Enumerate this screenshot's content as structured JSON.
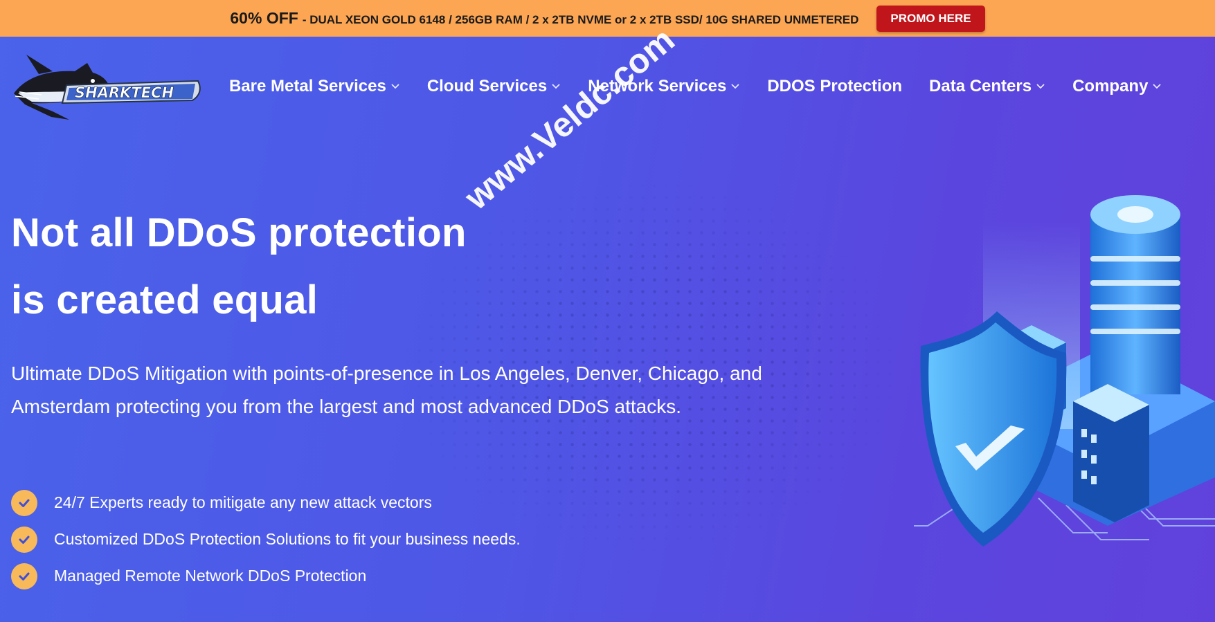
{
  "promo": {
    "highlight": "60% OFF",
    "detail": "- DUAL XEON GOLD 6148 / 256GB RAM / 2 x 2TB NVME or 2 x 2TB SSD/ 10G SHARED UNMETERED",
    "button_label": "PROMO HERE"
  },
  "logo": {
    "text": "SHARKTECH",
    "icon": "shark-logo"
  },
  "nav": [
    {
      "label": "Bare Metal Services",
      "has_dropdown": true
    },
    {
      "label": "Cloud Services",
      "has_dropdown": true
    },
    {
      "label": "Network Services",
      "has_dropdown": true
    },
    {
      "label": "DDOS Protection",
      "has_dropdown": false
    },
    {
      "label": "Data Centers",
      "has_dropdown": true
    },
    {
      "label": "Company",
      "has_dropdown": true
    }
  ],
  "hero": {
    "title_line1": "Not all DDoS protection",
    "title_line2": "is created equal",
    "description": "Ultimate DDoS Mitigation with points-of-presence in Los Angeles, Denver, Chicago, and Amsterdam protecting you from the largest and most advanced DDoS attacks.",
    "features": [
      "24/7 Experts ready to mitigate any new attack vectors",
      "Customized DDoS Protection Solutions to fit your business needs.",
      "Managed Remote Network DDoS Protection"
    ]
  },
  "watermark": "www.Veldc.com",
  "colors": {
    "promo_bar": "#fca552",
    "promo_button": "#c0151b",
    "background_start": "#4a63ea",
    "background_end": "#6141dc",
    "check_badge": "#f7b95a"
  }
}
